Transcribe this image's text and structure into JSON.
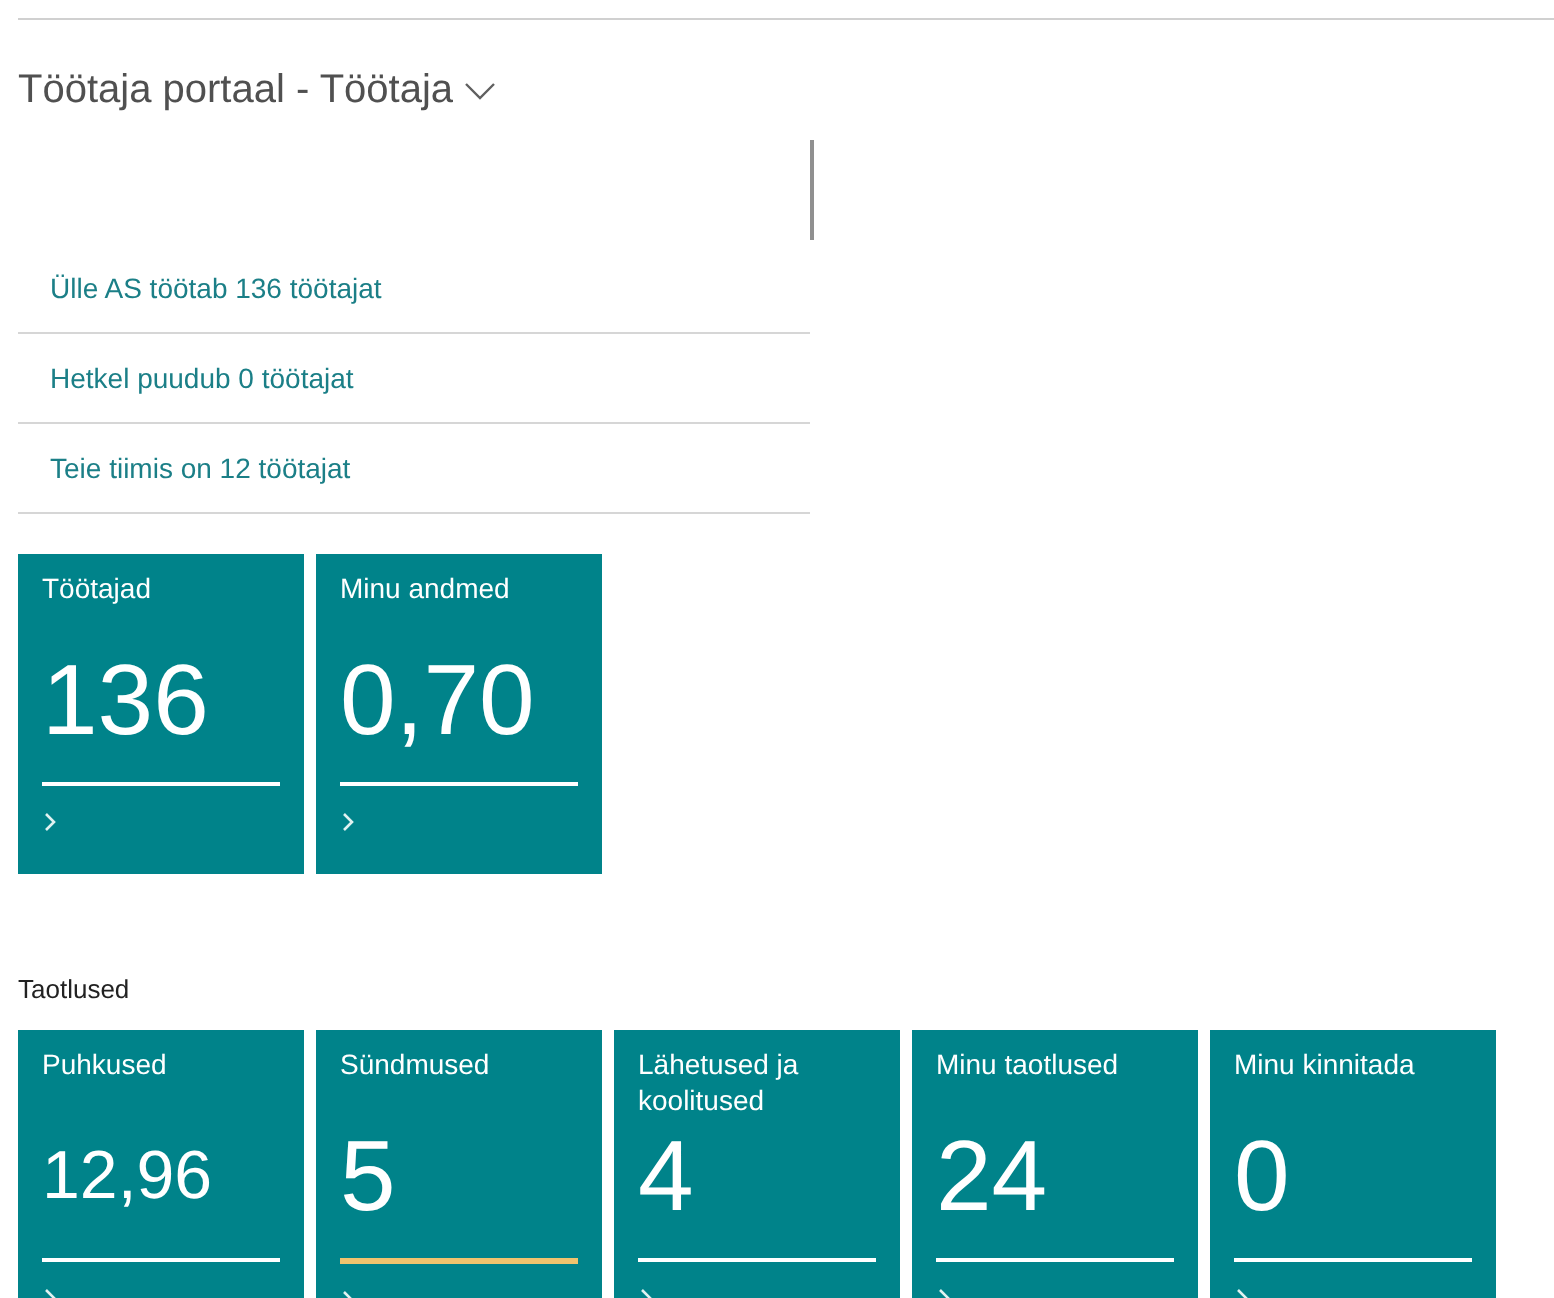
{
  "page": {
    "title": "Töötaja portaal - Töötaja"
  },
  "info_links": [
    {
      "label": "Ülle AS töötab 136 töötajat"
    },
    {
      "label": "Hetkel puudub 0 töötajat"
    },
    {
      "label": "Teie tiimis on 12 töötajat"
    }
  ],
  "tiles": [
    {
      "title": "Töötajad",
      "value": "136",
      "alert": false,
      "compact": false
    },
    {
      "title": "Minu andmed",
      "value": "0,70",
      "alert": false,
      "compact": false
    }
  ],
  "requests": {
    "heading": "Taotlused",
    "tiles": [
      {
        "title": "Puhkused",
        "value": "12,96",
        "alert": false,
        "compact": true
      },
      {
        "title": "Sündmused",
        "value": "5",
        "alert": true,
        "compact": false
      },
      {
        "title": "Lähetused ja koolitused",
        "value": "4",
        "alert": false,
        "compact": false
      },
      {
        "title": "Minu taotlused",
        "value": "24",
        "alert": false,
        "compact": false
      },
      {
        "title": "Minu kinnitada",
        "value": "0",
        "alert": false,
        "compact": false
      }
    ]
  }
}
